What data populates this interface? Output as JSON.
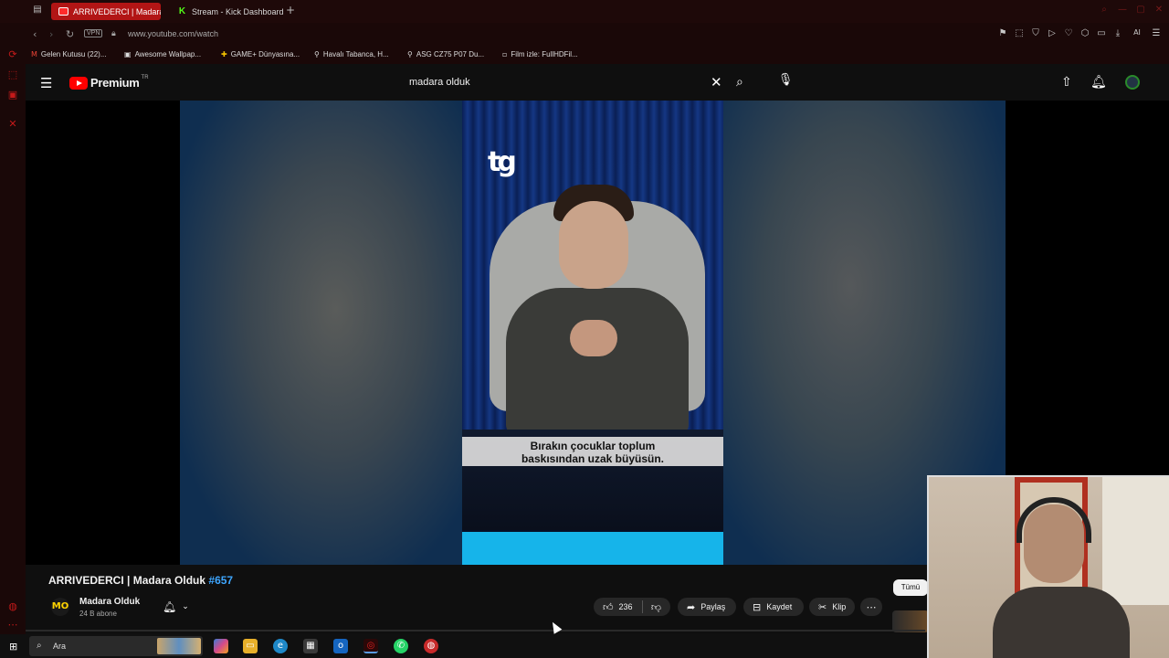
{
  "browser": {
    "tabs": [
      {
        "label": "ARRIVEDERCI | Madara Ol",
        "active": true
      },
      {
        "label": "Stream - Kick Dashboard",
        "active": false
      }
    ],
    "url": "www.youtube.com/watch",
    "vpn_label": "VPN",
    "bookmarks": [
      "Gelen Kutusu (22)...",
      "Awesome Wallpap...",
      "GAME+ Dünyasına...",
      "Havalı Tabanca, H...",
      "ASG CZ75 P07 Du...",
      "Film izle: FullHDFil..."
    ],
    "ai_label": "AI"
  },
  "youtube": {
    "brand": "Premium",
    "region": "TR",
    "search_query": "madara olduk"
  },
  "video": {
    "overlay_logo": "tg",
    "subtitle": [
      "Bırakın çocuklar toplum",
      "baskısından uzak büyüsün."
    ]
  },
  "details": {
    "title": "ARRIVEDERCI | Madara Olduk",
    "hashtag": "#657",
    "channel_initials": "MO",
    "channel_name": "Madara Olduk",
    "subscribers": "24 B abone",
    "likes": "236",
    "share_label": "Paylaş",
    "save_label": "Kaydet",
    "clip_label": "Klip",
    "chip_all": "Tümü"
  },
  "taskbar": {
    "search_placeholder": "Ara"
  },
  "colors": {
    "accent_red": "#b21515",
    "youtube_red": "#ff0000",
    "link_blue": "#3ea6ff",
    "cyan_band": "#16b4ea"
  }
}
